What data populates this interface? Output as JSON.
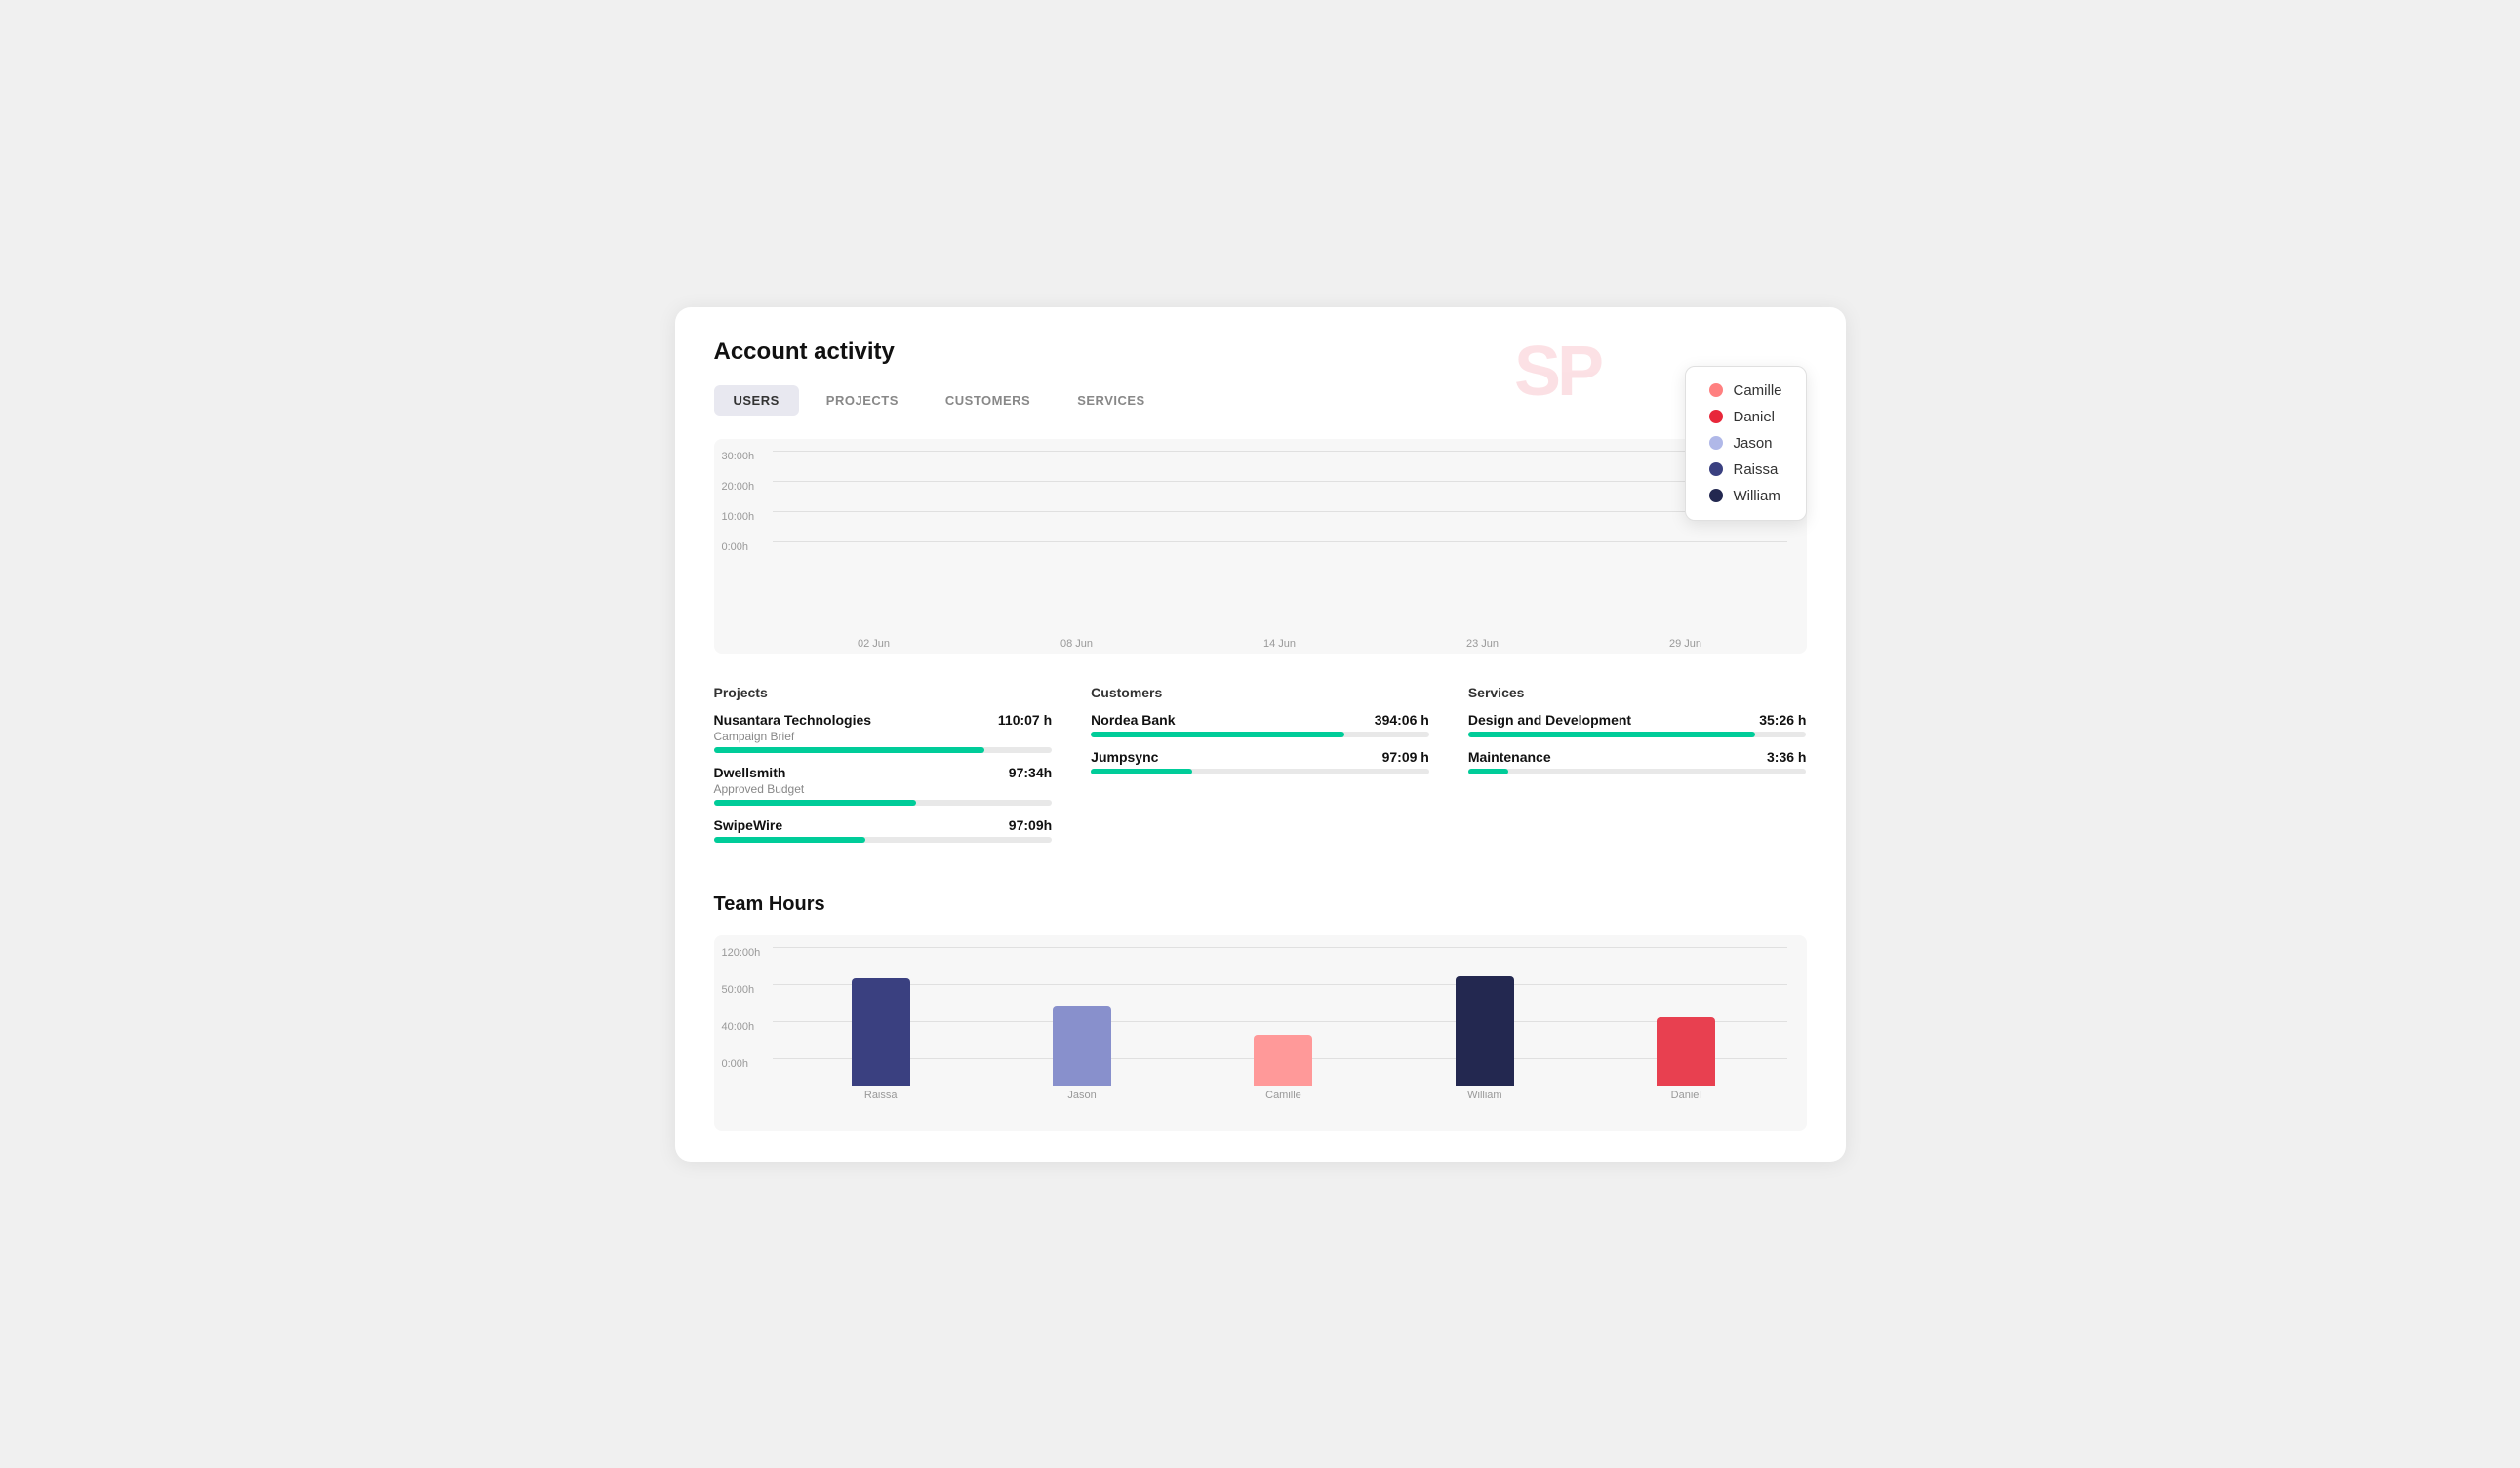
{
  "page": {
    "title": "Account activity"
  },
  "tabs": [
    {
      "id": "users",
      "label": "USERS",
      "active": true
    },
    {
      "id": "projects",
      "label": "PROJECTS",
      "active": false
    },
    {
      "id": "customers",
      "label": "CUSTOMERS",
      "active": false
    },
    {
      "id": "services",
      "label": "SERVICES",
      "active": false
    }
  ],
  "legend": {
    "items": [
      {
        "name": "Camille",
        "color": "#ff8080"
      },
      {
        "name": "Daniel",
        "color": "#e8273a"
      },
      {
        "name": "Jason",
        "color": "#b0b8e8"
      },
      {
        "name": "Raissa",
        "color": "#3a4080"
      },
      {
        "name": "William",
        "color": "#232850"
      }
    ]
  },
  "chart": {
    "y_labels": [
      "30:00h",
      "20:00h",
      "10:00h",
      "0:00h"
    ],
    "x_labels": [
      "02 Jun",
      "08 Jun",
      "14 Jun",
      "23 Jun",
      "29 Jun"
    ],
    "bar_groups": [
      {
        "x": "02 Jun",
        "bars": [
          {
            "color": "#ff9999",
            "height": 38
          },
          {
            "color": "#ff9999",
            "height": 48
          },
          {
            "color": "#ff7070",
            "height": 62
          }
        ]
      },
      {
        "x": "08 Jun",
        "bars": [
          {
            "color": "#ff4455",
            "height": 55
          },
          {
            "color": "#e8273a",
            "height": 20
          },
          {
            "color": "#e8273a",
            "height": 90
          }
        ]
      },
      {
        "x": "14 Jun",
        "bars": [
          {
            "color": "#3a4a9a",
            "height": 65
          },
          {
            "color": "#232850",
            "height": 22
          },
          {
            "color": "#232850",
            "height": 78
          }
        ]
      },
      {
        "x": "23 Jun",
        "bars": [
          {
            "color": "#3a4080",
            "height": 38
          },
          {
            "color": "#3a4080",
            "height": 72
          },
          {
            "color": "#3a4080",
            "height": 55
          }
        ]
      },
      {
        "x": "29 Jun",
        "bars": [
          {
            "color": "#b0b8e8",
            "height": 50
          },
          {
            "color": "#b0b8e8",
            "height": 30
          },
          {
            "color": "#b0b8e8",
            "height": 95
          }
        ]
      }
    ]
  },
  "projects": {
    "title": "Projects",
    "items": [
      {
        "name": "Nusantara Technologies",
        "sub": "Campaign Brief",
        "hours": "110:07 h",
        "progress": 80
      },
      {
        "name": "Dwellsmith",
        "sub": "Approved Budget",
        "hours": "97:34h",
        "progress": 60
      },
      {
        "name": "SwipeWire",
        "sub": "",
        "hours": "97:09h",
        "progress": 45
      }
    ]
  },
  "customers": {
    "title": "Customers",
    "items": [
      {
        "name": "Nordea Bank",
        "sub": "",
        "hours": "394:06 h",
        "progress": 75
      },
      {
        "name": "Jumpsync",
        "sub": "",
        "hours": "97:09 h",
        "progress": 30
      }
    ]
  },
  "services": {
    "title": "Services",
    "items": [
      {
        "name": "Design and Development",
        "sub": "",
        "hours": "35:26 h",
        "progress": 85
      },
      {
        "name": "Maintenance",
        "sub": "",
        "hours": "3:36 h",
        "progress": 12
      }
    ]
  },
  "team_hours": {
    "title": "Team Hours",
    "y_labels": [
      "120:00h",
      "50:00h",
      "40:00h",
      "0:00h"
    ],
    "bars": [
      {
        "name": "Raissa",
        "color": "#3a4080",
        "height": 110
      },
      {
        "name": "Jason",
        "color": "#8890cc",
        "height": 85
      },
      {
        "name": "Camille",
        "color": "#ff9999",
        "height": 55
      },
      {
        "name": "William",
        "color": "#232850",
        "height": 112
      },
      {
        "name": "Daniel",
        "color": "#e84050",
        "height": 72
      }
    ]
  }
}
